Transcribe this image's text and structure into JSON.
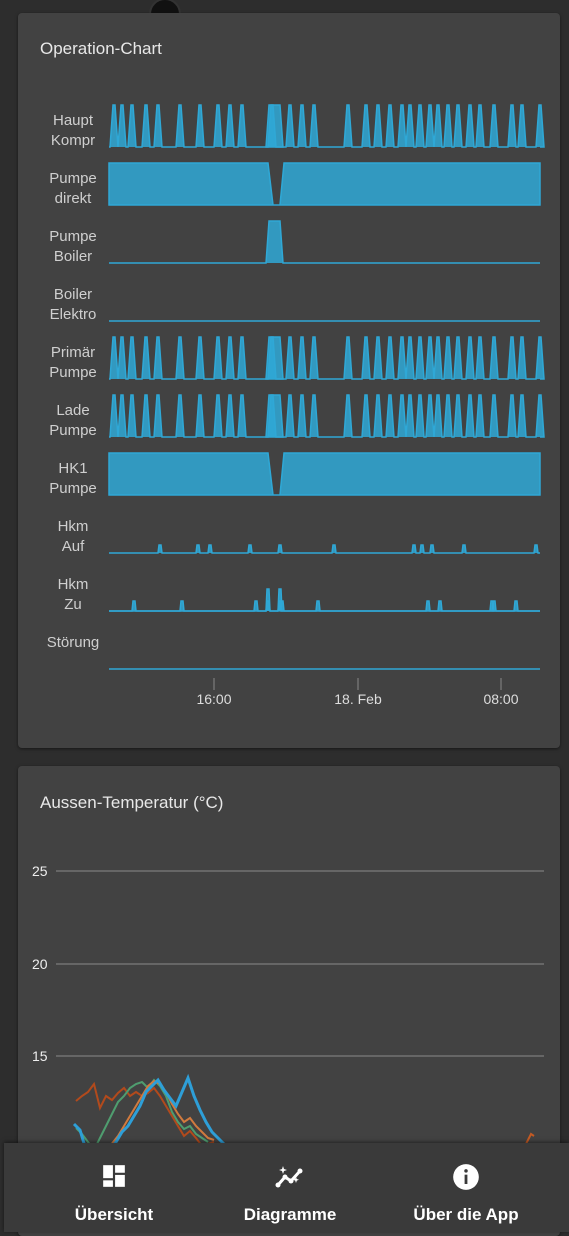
{
  "operation_chart": {
    "title": "Operation-Chart",
    "rows": [
      {
        "label": "Haupt\nKompr"
      },
      {
        "label": "Pumpe\ndirekt"
      },
      {
        "label": "Pumpe\nBoiler"
      },
      {
        "label": "Boiler\nElektro"
      },
      {
        "label": "Primär\nPumpe"
      },
      {
        "label": "Lade\nPumpe"
      },
      {
        "label": "HK1\nPumpe"
      },
      {
        "label": "Hkm\nAuf"
      },
      {
        "label": "Hkm\nZu"
      },
      {
        "label": "Störung"
      }
    ],
    "x_ticks": [
      "16:00",
      "18. Feb",
      "08:00"
    ],
    "color": "#2fa8d6"
  },
  "temperature_chart": {
    "title": "Aussen-Temperatur (°C)",
    "y_ticks": [
      "25",
      "20",
      "15"
    ],
    "series_colors": [
      "#2aa0d8",
      "#c0501e",
      "#4aa070",
      "#e08040"
    ]
  },
  "nav": {
    "items": [
      {
        "label": "Übersicht",
        "icon": "dashboard-icon"
      },
      {
        "label": "Diagramme",
        "icon": "chart-icon"
      },
      {
        "label": "Über die App",
        "icon": "info-icon"
      }
    ]
  },
  "chart_data": [
    {
      "type": "area",
      "title": "Operation-Chart",
      "categories": [
        "Haupt Kompr",
        "Pumpe direkt",
        "Pumpe Boiler",
        "Boiler Elektro",
        "Primär Pumpe",
        "Lade Pumpe",
        "HK1 Pumpe",
        "Hkm Auf",
        "Hkm Zu",
        "Störung"
      ],
      "x_ticks": [
        "16:00",
        "18. Feb",
        "08:00"
      ]
    },
    {
      "type": "line",
      "title": "Aussen-Temperatur (°C)",
      "y_ticks": [
        25,
        20,
        15
      ]
    }
  ]
}
